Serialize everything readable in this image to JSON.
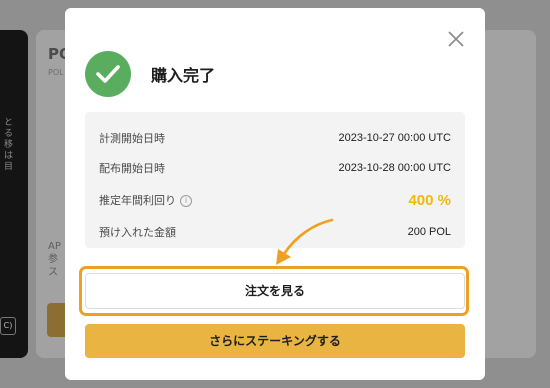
{
  "background": {
    "left_panel_text": "とる移は目",
    "left_panel_badge": "C)",
    "card_title": "PO",
    "card_subtitle": "POL",
    "card_body": "AP 参 ス"
  },
  "modal": {
    "title": "購入完了",
    "icons": {
      "success": "check-circle-icon",
      "close": "close-icon",
      "info": "info-circle-icon",
      "pointer": "curved-arrow-icon"
    },
    "rows": [
      {
        "label": "計測開始日時",
        "value": "2023-10-27 00:00 UTC"
      },
      {
        "label": "配布開始日時",
        "value": "2023-10-28 00:00 UTC"
      },
      {
        "label": "推定年間利回り",
        "value": "400 %"
      },
      {
        "label": "預け入れた金額",
        "value": "200 POL"
      }
    ],
    "view_order_label": "注文を見る",
    "stake_more_label": "さらにステーキングする"
  },
  "colors": {
    "accent": "#f0b90b",
    "primary_button": "#e9b441",
    "success": "#5aac5e",
    "highlight": "#f0a020"
  }
}
